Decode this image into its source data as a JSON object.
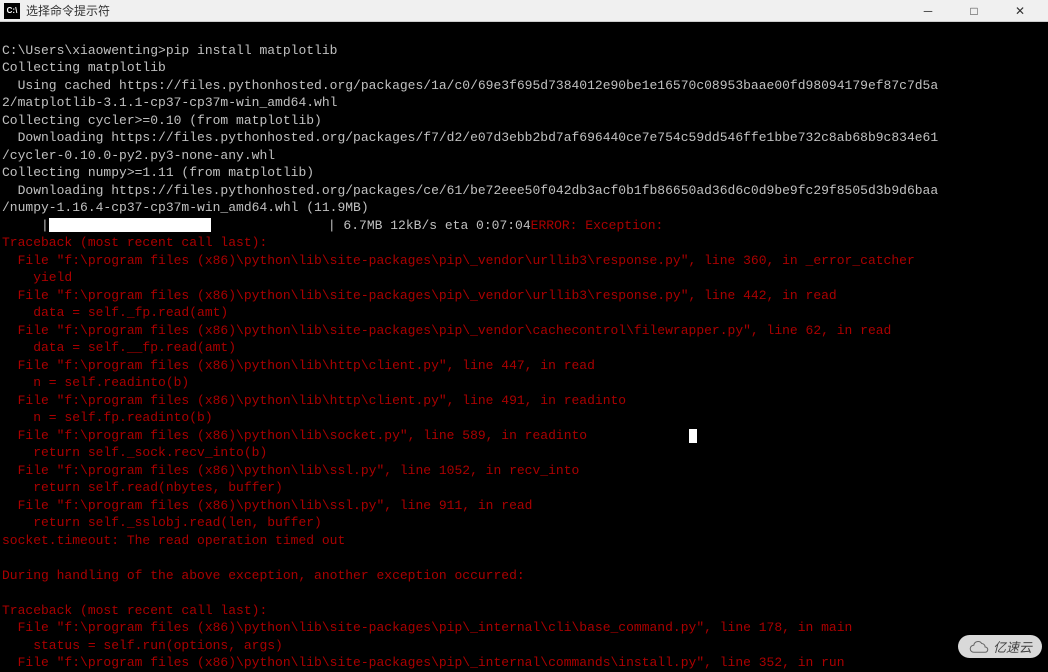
{
  "titlebar": {
    "icon_text": "C:\\",
    "title": "选择命令提示符"
  },
  "terminal": {
    "prompt": "C:\\Users\\xiaowenting>",
    "command": "pip install matplotlib",
    "lines": {
      "l1": "Collecting matplotlib",
      "l2": "  Using cached https://files.pythonhosted.org/packages/1a/c0/69e3f695d7384012e90be1e16570c08953baae00fd98094179ef87c7d5a",
      "l3": "2/matplotlib-3.1.1-cp37-cp37m-win_amd64.whl",
      "l4": "Collecting cycler>=0.10 (from matplotlib)",
      "l5": "  Downloading https://files.pythonhosted.org/packages/f7/d2/e07d3ebb2bd7af696440ce7e754c59dd546ffe1bbe732c8ab68b9c834e61",
      "l6": "/cycler-0.10.0-py2.py3-none-any.whl",
      "l7": "Collecting numpy>=1.11 (from matplotlib)",
      "l8": "  Downloading https://files.pythonhosted.org/packages/ce/61/be72eee50f042db3acf0b1fb86650ad36d6c0d9be9fc29f8505d3b9d6baa",
      "l9": "/numpy-1.16.4-cp37-cp37m-win_amd64.whl (11.9MB)",
      "progress_prefix": "     |",
      "progress_suffix": "               | 6.7MB 12kB/s eta 0:07:04",
      "error_label": "ERROR: Exception:",
      "t1": "Traceback (most recent call last):",
      "t2": "  File \"f:\\program files (x86)\\python\\lib\\site-packages\\pip\\_vendor\\urllib3\\response.py\", line 360, in _error_catcher",
      "t3": "    yield",
      "t4": "  File \"f:\\program files (x86)\\python\\lib\\site-packages\\pip\\_vendor\\urllib3\\response.py\", line 442, in read",
      "t5": "    data = self._fp.read(amt)",
      "t6": "  File \"f:\\program files (x86)\\python\\lib\\site-packages\\pip\\_vendor\\cachecontrol\\filewrapper.py\", line 62, in read",
      "t7": "    data = self.__fp.read(amt)",
      "t8": "  File \"f:\\program files (x86)\\python\\lib\\http\\client.py\", line 447, in read",
      "t9": "    n = self.readinto(b)",
      "t10": "  File \"f:\\program files (x86)\\python\\lib\\http\\client.py\", line 491, in readinto",
      "t11": "    n = self.fp.readinto(b)",
      "t12": "  File \"f:\\program files (x86)\\python\\lib\\socket.py\", line 589, in readinto",
      "t13": "    return self._sock.recv_into(b)",
      "t14": "  File \"f:\\program files (x86)\\python\\lib\\ssl.py\", line 1052, in recv_into",
      "t15": "    return self.read(nbytes, buffer)",
      "t16": "  File \"f:\\program files (x86)\\python\\lib\\ssl.py\", line 911, in read",
      "t17": "    return self._sslobj.read(len, buffer)",
      "t18": "socket.timeout: The read operation timed out",
      "blank": "",
      "t19": "During handling of the above exception, another exception occurred:",
      "t20": "Traceback (most recent call last):",
      "t21": "  File \"f:\\program files (x86)\\python\\lib\\site-packages\\pip\\_internal\\cli\\base_command.py\", line 178, in main",
      "t22": "    status = self.run(options, args)",
      "t23": "  File \"f:\\program files (x86)\\python\\lib\\site-packages\\pip\\_internal\\commands\\install.py\", line 352, in run"
    }
  },
  "watermark": {
    "text": "亿速云"
  }
}
